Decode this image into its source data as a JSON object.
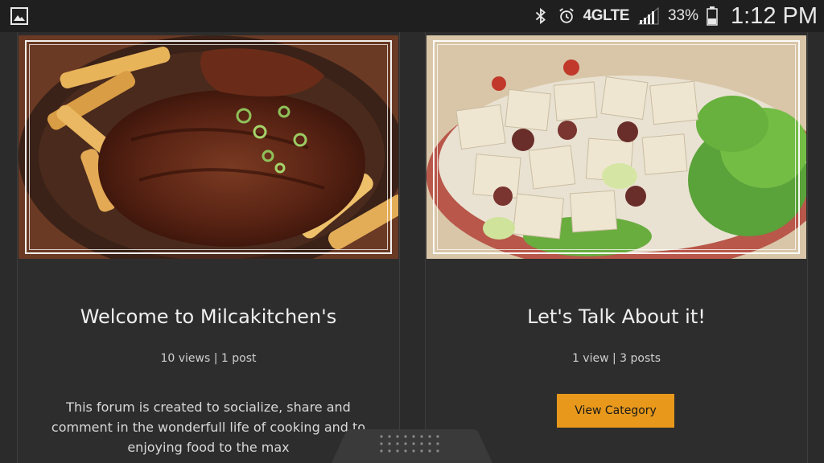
{
  "status_bar": {
    "network": "4GLTE",
    "battery": "33%",
    "time": "1:12 PM"
  },
  "cards": [
    {
      "title": "Welcome to Milcakitchen's",
      "stats": "10 views | 1 post",
      "description": "This forum is created to socialize, share and comment in the wonderfull life of cooking and to enjoying food to the max"
    },
    {
      "title": "Let's Talk About it!",
      "stats": "1 view | 3 posts",
      "button_label": "View Category"
    }
  ],
  "colors": {
    "accent": "#e8981a",
    "background": "#2b2b2b",
    "status_bar": "#1f1f1f"
  }
}
